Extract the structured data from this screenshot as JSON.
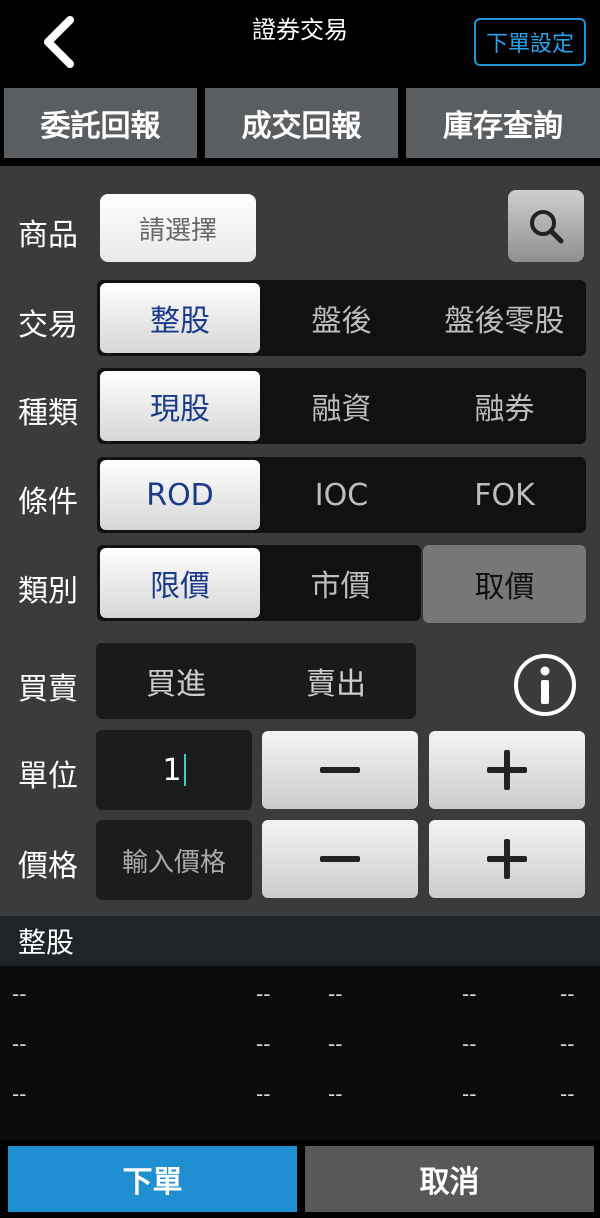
{
  "header": {
    "title": "證券交易",
    "settings_label": "下單設定",
    "back_icon": "chevron-left-icon"
  },
  "tabs": [
    {
      "label": "委託回報"
    },
    {
      "label": "成交回報"
    },
    {
      "label": "庫存查詢"
    }
  ],
  "form": {
    "product": {
      "label": "商品",
      "placeholder": "請選擇",
      "search_icon": "search-icon"
    },
    "trade": {
      "label": "交易",
      "options": [
        "整股",
        "盤後",
        "盤後零股"
      ],
      "selected": "整股"
    },
    "type": {
      "label": "種類",
      "options": [
        "現股",
        "融資",
        "融券"
      ],
      "selected": "現股"
    },
    "condition": {
      "label": "條件",
      "options": [
        "ROD",
        "IOC",
        "FOK"
      ],
      "selected": "ROD"
    },
    "category": {
      "label": "類別",
      "options": [
        "限價",
        "市價"
      ],
      "selected": "限價",
      "quote_button": "取價"
    },
    "buysell": {
      "label": "買賣",
      "options": [
        "買進",
        "賣出"
      ],
      "info_icon": "info-icon"
    },
    "unit": {
      "label": "單位",
      "value": "1",
      "minus": "minus-icon",
      "plus": "plus-icon"
    },
    "price": {
      "label": "價格",
      "placeholder": "輸入價格",
      "minus": "minus-icon",
      "plus": "plus-icon"
    }
  },
  "quote": {
    "section_title": "整股",
    "rows": [
      [
        "--",
        "--",
        "--",
        "--",
        "--"
      ],
      [
        "--",
        "--",
        "--",
        "--",
        "--"
      ],
      [
        "--",
        "--",
        "--",
        "--",
        "--"
      ]
    ]
  },
  "bottom": {
    "submit_label": "下單",
    "cancel_label": "取消"
  },
  "colors": {
    "accent": "#1f8fd2",
    "active_text": "#1a3a8a",
    "panel": "#3b3b3b"
  }
}
